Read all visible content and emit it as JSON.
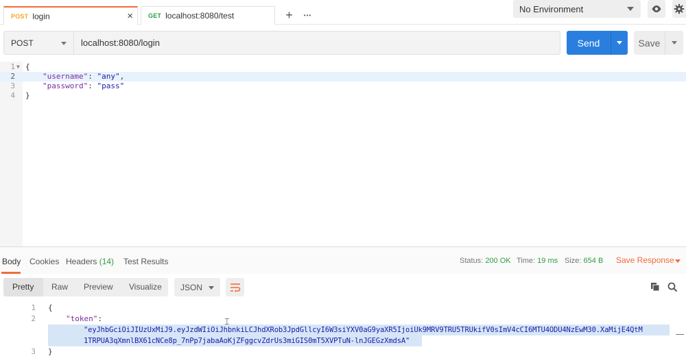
{
  "tabs": [
    {
      "method": "POST",
      "title": "login",
      "close": "×"
    },
    {
      "method": "GET",
      "title": "localhost:8080/test"
    }
  ],
  "tabbar": {
    "add": "+",
    "more": "•••"
  },
  "environment": {
    "selected": "No Environment"
  },
  "request": {
    "method": "POST",
    "url": "localhost:8080/login",
    "send_label": "Send",
    "save_label": "Save"
  },
  "editor": {
    "lines": [
      {
        "n": "1",
        "text": "{"
      },
      {
        "n": "2",
        "key": "\"username\"",
        "sep": ": ",
        "value": "\"any\"",
        "trail": ","
      },
      {
        "n": "3",
        "key": "\"password\"",
        "sep": ": ",
        "value": "\"pass\"",
        "trail": ""
      },
      {
        "n": "4",
        "text": "}"
      }
    ]
  },
  "response": {
    "tabs": {
      "body": "Body",
      "cookies": "Cookies",
      "headers": "Headers",
      "headers_count": "(14)",
      "tests": "Test Results"
    },
    "status_label": "Status:",
    "status": "200 OK",
    "time_label": "Time:",
    "time": "19 ms",
    "size_label": "Size:",
    "size": "654 B",
    "save_response": "Save Response",
    "views": {
      "pretty": "Pretty",
      "raw": "Raw",
      "preview": "Preview",
      "visualize": "Visualize"
    },
    "format": "JSON",
    "body": {
      "line1": "{",
      "line2_key": "\"token\"",
      "line2_sep": ":",
      "token_part1": "\"eyJhbGciOiJIUzUxMiJ9.eyJzdWIiOiJhbnkiLCJhdXRob3JpdGllcyI6W3siYXV0aG9yaXR5IjoiUk9MRV9TRU5TRUkifV0sImV4cCI6MTU4ODU4NzEwM30.XaMijE4QtM",
      "token_part2": "1TRPUA3qXmnlBX61cNCe8p_7nPp7jabaAoKjZFggcvZdrUs3miGIS0mT5XVPTuN-lnJGEGzXmdsA\"",
      "line3": "}",
      "n1": "1",
      "n2": "2",
      "n3": "3"
    }
  },
  "colors": {
    "accent": "#f26b3a",
    "send": "#2a7fde",
    "status_ok": "#2e9d45",
    "post": "#f5a623",
    "get": "#2e9d45"
  }
}
